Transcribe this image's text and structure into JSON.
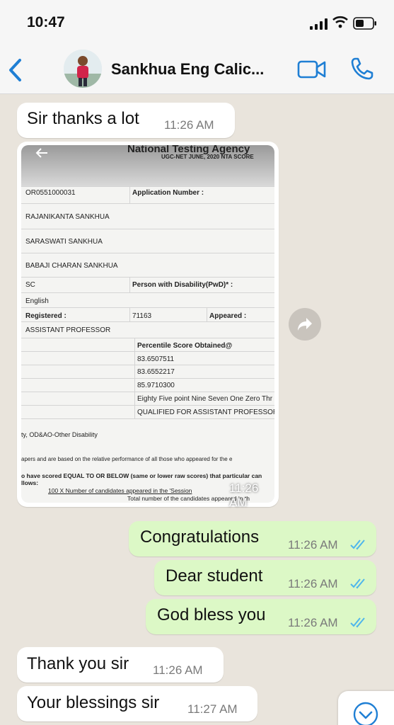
{
  "status_bar": {
    "time": "10:47"
  },
  "header": {
    "contact_name": "Sankhua Eng Calic..."
  },
  "messages": [
    {
      "text": "Sir thanks a lot",
      "time": "11:26 AM"
    },
    {
      "text": "Congratulations",
      "time": "11:26 AM"
    },
    {
      "text": "Dear student",
      "time": "11:26 AM"
    },
    {
      "text": "God bless you",
      "time": "11:26 AM"
    },
    {
      "text": "Thank you sir",
      "time": "11:26 AM"
    },
    {
      "text": "Your blessings sir",
      "time": "11:27 AM"
    }
  ],
  "image_message": {
    "time": "11:26 AM",
    "doc": {
      "header1": "National Testing Agency",
      "header2": "UGC-NET JUNE, 2020 NTA SCORE",
      "roll": "OR0551000031",
      "application_number_label": "Application Number :",
      "candidate": "RAJANIKANTA SANKHUA",
      "mother": "SARASWATI SANKHUA",
      "father": "BABAJI CHARAN SANKHUA",
      "category": "SC",
      "pwd_label": "Person with Disability(PwD)* :",
      "medium": "English",
      "registered_label": "Registered :",
      "registered_value": "71163",
      "appeared_label": "Appeared :",
      "post": "ASSISTANT PROFESSOR",
      "percentile_label": "Percentile Score Obtained@",
      "score1": "83.6507511",
      "score2": "83.6552217",
      "score3": "85.9710300",
      "score_words": "Eighty Five point Nine Seven One Zero Thr",
      "qualified": "QUALIFIED FOR ASSISTANT PROFESSOR",
      "note1": "ty, OD&AO-Other Disability",
      "note2": "apers and are based on the relative performance of all those who appeared for the e",
      "note3": "o have scored EQUAL TO OR BELOW (same or lower raw scores) that particular can",
      "note4": "llows:",
      "formula": "100 X Number of candidates appeared in the 'Session",
      "formula2": "Total number of the candidates appeared in th"
    }
  },
  "colors": {
    "accent": "#1f7fd4",
    "incoming": "#ffffff",
    "outgoing": "#dcf8c6",
    "tick_read": "#4fb6ec"
  },
  "icons": [
    "back-chevron-icon",
    "video-call-icon",
    "phone-call-icon",
    "forward-icon",
    "scroll-down-chevron-icon",
    "double-tick-icon"
  ]
}
